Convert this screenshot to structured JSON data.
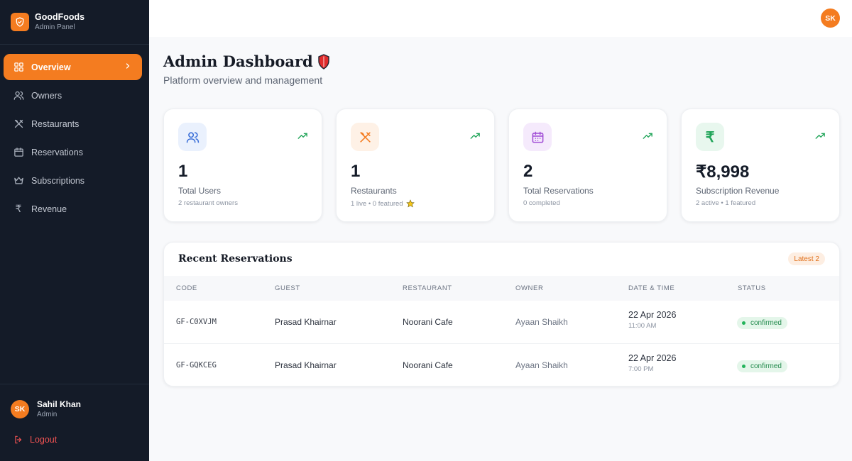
{
  "brand": {
    "name": "GoodFoods",
    "subtitle": "Admin Panel"
  },
  "sidebar": {
    "items": [
      {
        "label": "Overview",
        "icon": "grid-icon",
        "active": true
      },
      {
        "label": "Owners",
        "icon": "users-icon"
      },
      {
        "label": "Restaurants",
        "icon": "utensils-icon"
      },
      {
        "label": "Reservations",
        "icon": "calendar-icon"
      },
      {
        "label": "Subscriptions",
        "icon": "crown-icon"
      },
      {
        "label": "Revenue",
        "icon": "rupee-icon"
      }
    ]
  },
  "user": {
    "initials": "SK",
    "name": "Sahil Khan",
    "role": "Admin"
  },
  "logout_label": "Logout",
  "header": {
    "avatar_initials": "SK"
  },
  "page": {
    "title": "Admin Dashboard",
    "subtitle": "Platform overview and management"
  },
  "stats": [
    {
      "value": "1",
      "label": "Total Users",
      "note": "2 restaurant owners",
      "icon": "users-icon",
      "color": "#3b6fd8"
    },
    {
      "value": "1",
      "label": "Restaurants",
      "note": "1 live • 0 featured",
      "icon": "utensils-icon",
      "color": "#f47c20"
    },
    {
      "value": "2",
      "label": "Total Reservations",
      "note": "0 completed",
      "icon": "calendar-icon",
      "color": "#a24fd6"
    },
    {
      "value": "₹8,998",
      "label": "Subscription Revenue",
      "note": "2 active • 1 featured",
      "icon": "rupee-icon",
      "color": "#22a55a"
    }
  ],
  "reservations": {
    "title": "Recent Reservations",
    "badge": "Latest 2",
    "columns": [
      "CODE",
      "GUEST",
      "RESTAURANT",
      "OWNER",
      "DATE & TIME",
      "STATUS"
    ],
    "rows": [
      {
        "code": "GF-C0XVJM",
        "guest": "Prasad Khairnar",
        "restaurant": "Noorani Cafe",
        "owner": "Ayaan Shaikh",
        "date": "22 Apr 2026",
        "time": "11:00 AM",
        "status": "confirmed"
      },
      {
        "code": "GF-GQKCEG",
        "guest": "Prasad Khairnar",
        "restaurant": "Noorani Cafe",
        "owner": "Ayaan Shaikh",
        "date": "22 Apr 2026",
        "time": "7:00 PM",
        "status": "confirmed"
      }
    ]
  },
  "colors": {
    "accent": "#f47c20",
    "sidebar_bg": "#141b28",
    "success": "#22a55a",
    "danger": "#f05252"
  }
}
